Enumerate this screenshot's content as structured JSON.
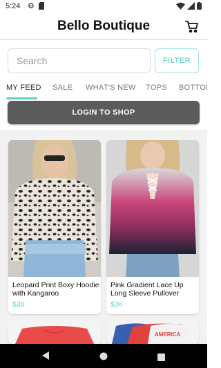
{
  "status_bar": {
    "time": "5:24"
  },
  "app": {
    "title": "Bello Boutique"
  },
  "search": {
    "placeholder": "Search",
    "filter_label": "FILTER"
  },
  "tabs": [
    {
      "label": "MY FEED",
      "active": true
    },
    {
      "label": "SALE",
      "active": false
    },
    {
      "label": "WHAT'S NEW",
      "active": false
    },
    {
      "label": "TOPS",
      "active": false
    },
    {
      "label": "BOTTOMS",
      "active": false
    }
  ],
  "login": {
    "label": "LOGIN TO SHOP"
  },
  "products": [
    {
      "name": "Leopard Print Boxy Hoodie with Kangaroo",
      "price": "$36"
    },
    {
      "name": "Pink Gradient Lace Up Long Sleeve Pullover",
      "price": "$36"
    },
    {
      "name": "",
      "price": ""
    },
    {
      "name": "",
      "price": ""
    }
  ],
  "partial_tee_text": "AMERICA",
  "colors": {
    "accent": "#5ccfcf",
    "login_bg": "#5b5b5b"
  }
}
